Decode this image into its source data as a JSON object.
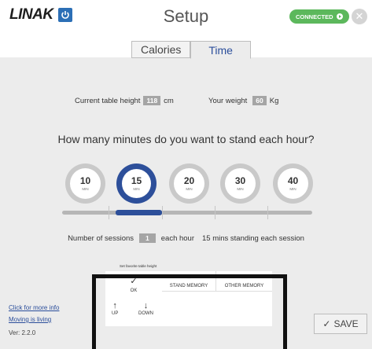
{
  "header": {
    "brand": "LINAK",
    "title": "Setup",
    "connection": "CONNECTED"
  },
  "tabs": [
    {
      "label": "Calories",
      "active": false
    },
    {
      "label": "Time",
      "active": true
    }
  ],
  "user": {
    "height_label": "Current table height",
    "height_value": "118",
    "height_unit": "cm",
    "weight_label": "Your weight",
    "weight_value": "60",
    "weight_unit": "Kg"
  },
  "question": "How many minutes do you want to stand each hour?",
  "minute_options": [
    {
      "value": "10",
      "unit": "MIN",
      "selected": false
    },
    {
      "value": "15",
      "unit": "MIN",
      "selected": true
    },
    {
      "value": "20",
      "unit": "MIN",
      "selected": false
    },
    {
      "value": "30",
      "unit": "MIN",
      "selected": false
    },
    {
      "value": "40",
      "unit": "MIN",
      "selected": false
    }
  ],
  "sessions": {
    "label": "Number of sessions",
    "value": "1",
    "suffix": "each hour",
    "summary": "15 mins standing each session"
  },
  "memory": {
    "favorite_label": "Set favorite table height",
    "ok": "OK",
    "stand": "STAND MEMORY",
    "other": "OTHER MEMORY",
    "up": "UP",
    "down": "DOWN"
  },
  "footer": {
    "link1": "Click for more info",
    "link2": "Moving is living",
    "version": "Ver: 2.2.0"
  },
  "save_label": "SAVE",
  "colors": {
    "accent": "#2d4f9a",
    "connected": "#5cb85c",
    "panel_bg": "#ececec"
  }
}
